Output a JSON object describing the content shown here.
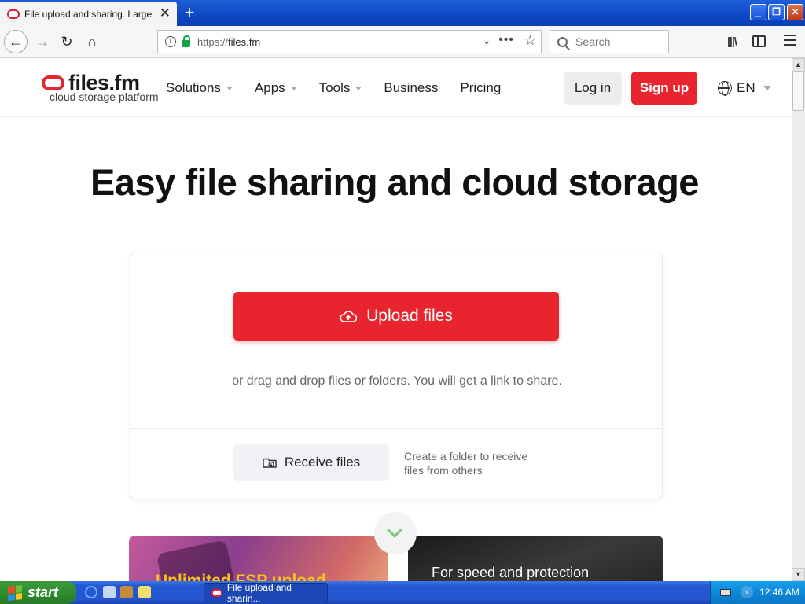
{
  "browser": {
    "tab_title": "File upload and sharing. Large file t",
    "tab_close": "✕",
    "new_tab": "+",
    "url_protocol": "https://",
    "url_host": "files.fm",
    "search_placeholder": "Search"
  },
  "site": {
    "logo_name": "files.fm",
    "logo_tagline": "cloud storage platform",
    "nav": [
      {
        "label": "Solutions",
        "has_dropdown": true
      },
      {
        "label": "Apps",
        "has_dropdown": true
      },
      {
        "label": "Tools",
        "has_dropdown": true
      },
      {
        "label": "Business",
        "has_dropdown": false
      },
      {
        "label": "Pricing",
        "has_dropdown": false
      }
    ],
    "login_label": "Log in",
    "signup_label": "Sign up",
    "language": "EN",
    "accent_color": "#e8242f"
  },
  "hero": {
    "title": "Easy file sharing and cloud storage"
  },
  "upload_card": {
    "upload_label": "Upload files",
    "upload_hint": "or drag and drop files or folders. You will get a link to share.",
    "receive_label": "Receive files",
    "receive_hint": "Create a folder to receive files from others"
  },
  "promos": {
    "left_text": "Unlimited FSP upload",
    "right_text": "For speed and protection"
  },
  "taskbar": {
    "start_label": "start",
    "task_label": "File upload and sharin...",
    "clock": "12:46 AM",
    "tray_expand": "‹"
  }
}
